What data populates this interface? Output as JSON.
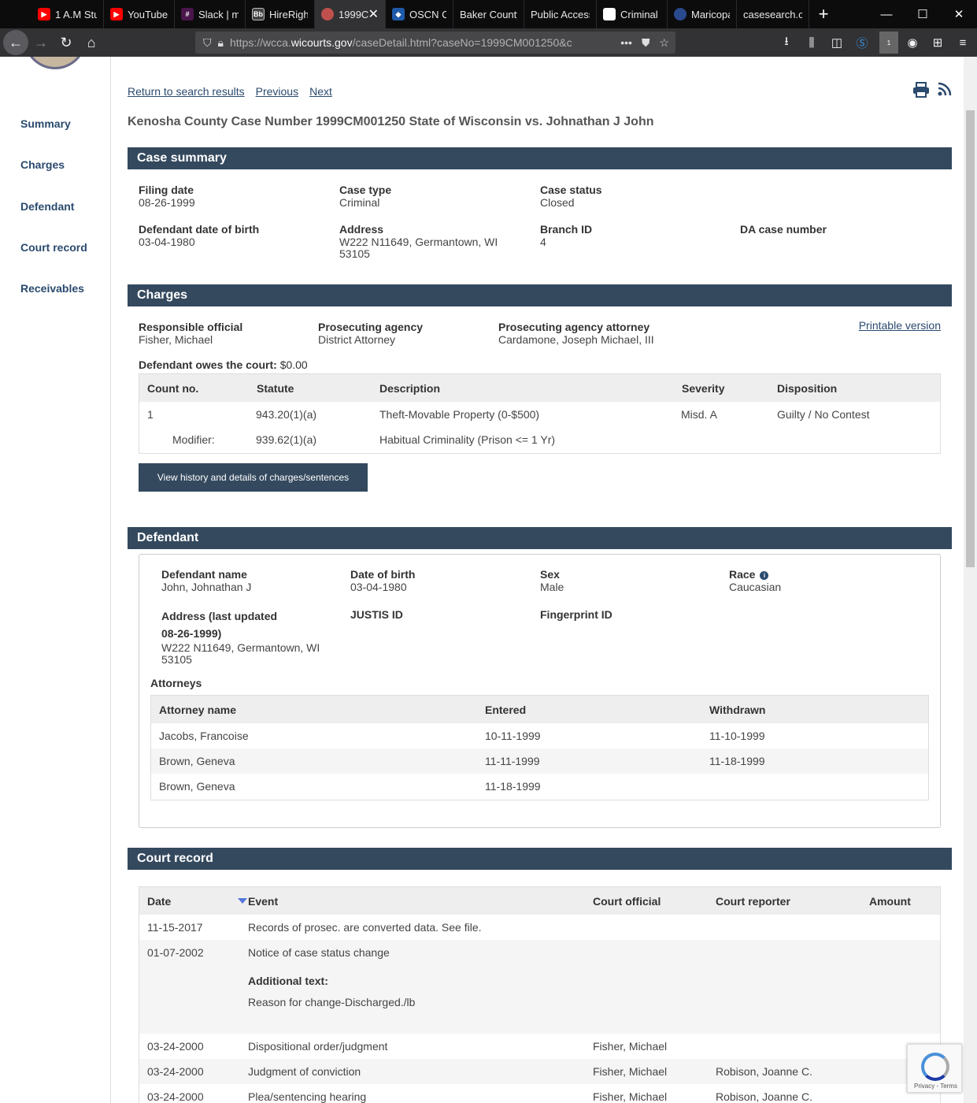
{
  "browser": {
    "tabs": [
      {
        "label": "1 A.M Stu",
        "icon_color": "#ff0000"
      },
      {
        "label": "YouTube",
        "icon_color": "#ff0000"
      },
      {
        "label": "Slack | m",
        "icon_color": "#4a154b"
      },
      {
        "label": "HireRigh",
        "icon_color": "#444444"
      },
      {
        "label": "1999C",
        "icon_color": "#c0504d"
      },
      {
        "label": "OSCN Ca",
        "icon_color": "#1e5aa8"
      },
      {
        "label": "Baker County",
        "icon_color": ""
      },
      {
        "label": "Public Access",
        "icon_color": ""
      },
      {
        "label": "Criminal",
        "icon_color": "#ffffff"
      },
      {
        "label": "Maricopa",
        "icon_color": "#2a4a8e"
      },
      {
        "label": "casesearch.c",
        "icon_color": ""
      }
    ],
    "url_prefix": "https://wcca.",
    "url_domain": "wicourts.gov",
    "url_suffix": "/caseDetail.html?caseNo=1999CM001250&c",
    "more_label": "•••",
    "badge_count": "1"
  },
  "sidebar": {
    "items": [
      "Summary",
      "Charges",
      "Defendant",
      "Court record",
      "Receivables"
    ]
  },
  "toplinks": {
    "return": "Return to search results",
    "previous": "Previous",
    "next": "Next"
  },
  "case_title": "Kenosha County Case Number 1999CM001250 State of Wisconsin vs. Johnathan J John",
  "summary": {
    "heading": "Case summary",
    "filing_date_label": "Filing date",
    "filing_date": "08-26-1999",
    "case_type_label": "Case type",
    "case_type": "Criminal",
    "case_status_label": "Case status",
    "case_status": "Closed",
    "dob_label": "Defendant date of birth",
    "dob": "03-04-1980",
    "address_label": "Address",
    "address_line1": "W222 N11649, Germantown, WI",
    "address_line2": "53105",
    "branch_label": "Branch ID",
    "branch": "4",
    "da_label": "DA case number",
    "da": ""
  },
  "charges": {
    "heading": "Charges",
    "official_label": "Responsible official",
    "official": "Fisher, Michael",
    "agency_label": "Prosecuting agency",
    "agency": "District Attorney",
    "attorney_label": "Prosecuting agency attorney",
    "attorney": "Cardamone, Joseph Michael, III",
    "printable": "Printable version",
    "owes_label": "Defendant owes the court:",
    "owes": "$0.00",
    "columns": [
      "Count no.",
      "Statute",
      "Description",
      "Severity",
      "Disposition"
    ],
    "row": {
      "count": "1",
      "statute": "943.20(1)(a)",
      "description": "Theft-Movable Property (0-$500)",
      "severity": "Misd. A",
      "disposition": "Guilty / No Contest"
    },
    "modifier": {
      "label": "Modifier:",
      "statute": "939.62(1)(a)",
      "description": "Habitual Criminality (Prison <= 1 Yr)"
    },
    "history_button": "View history and details of charges/sentences"
  },
  "defendant": {
    "heading": "Defendant",
    "name_label": "Defendant name",
    "name": "John, Johnathan J",
    "dob_label": "Date of birth",
    "dob": "03-04-1980",
    "sex_label": "Sex",
    "sex": "Male",
    "race_label": "Race",
    "race": "Caucasian",
    "address_label1": "Address (last updated",
    "address_label2": "08-26-1999)",
    "address_line1": "W222 N11649, Germantown, WI",
    "address_line2": "53105",
    "justis_label": "JUSTIS ID",
    "fingerprint_label": "Fingerprint ID",
    "attorneys_label": "Attorneys",
    "attorney_columns": [
      "Attorney name",
      "Entered",
      "Withdrawn"
    ],
    "attorneys": [
      {
        "name": "Jacobs, Francoise",
        "entered": "10-11-1999",
        "withdrawn": "11-10-1999"
      },
      {
        "name": "Brown, Geneva",
        "entered": "11-11-1999",
        "withdrawn": "11-18-1999"
      },
      {
        "name": "Brown, Geneva",
        "entered": "11-18-1999",
        "withdrawn": ""
      }
    ]
  },
  "court_record": {
    "heading": "Court record",
    "columns": [
      "Date",
      "Event",
      "Court official",
      "Court reporter",
      "Amount"
    ],
    "rows": [
      {
        "date": "11-15-2017",
        "event": "Records of prosec. are converted data. See file.",
        "official": "",
        "reporter": "",
        "amount": ""
      },
      {
        "date": "01-07-2002",
        "event": "Notice of case status change",
        "official": "",
        "reporter": "",
        "amount": "",
        "additional_label": "Additional text:",
        "additional": "Reason for change-Discharged./lb"
      },
      {
        "date": "03-24-2000",
        "event": "Dispositional order/judgment",
        "official": "Fisher, Michael",
        "reporter": "",
        "amount": ""
      },
      {
        "date": "03-24-2000",
        "event": "Judgment of conviction",
        "official": "Fisher, Michael",
        "reporter": "Robison, Joanne C.",
        "amount": ""
      },
      {
        "date": "03-24-2000",
        "event": "Plea/sentencing hearing",
        "official": "Fisher, Michael",
        "reporter": "Robison, Joanne C.",
        "amount": ""
      }
    ]
  },
  "recaptcha": {
    "text": "Privacy - Terms"
  },
  "colors": {
    "header_bar": "#34495e",
    "link": "#2a4a6e"
  }
}
